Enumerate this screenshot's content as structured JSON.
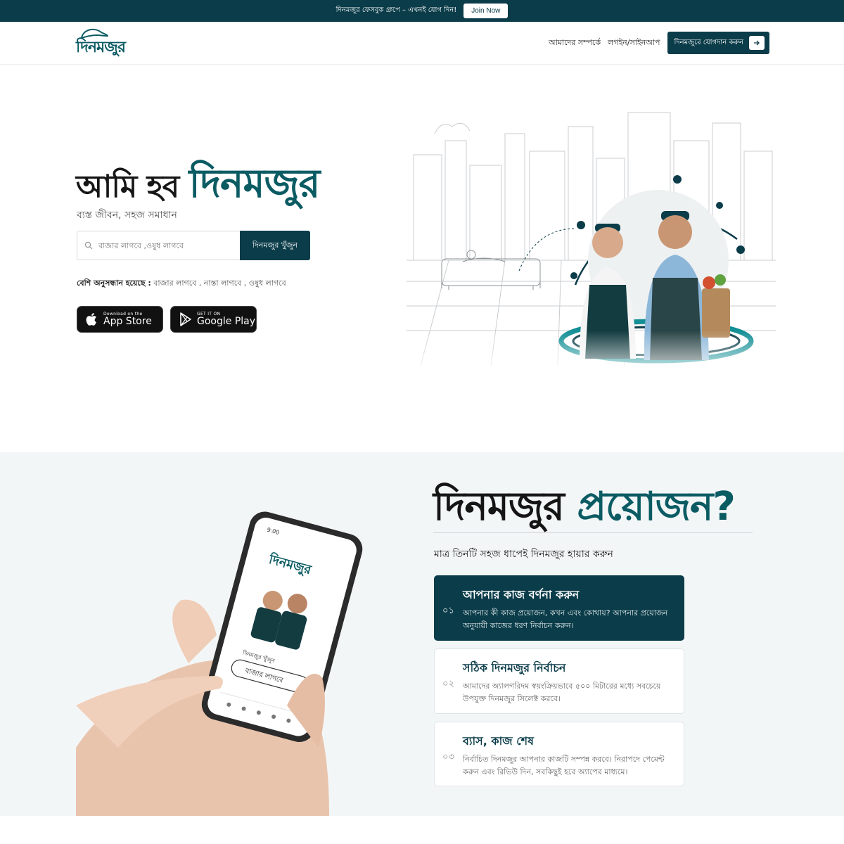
{
  "announcement": {
    "text": "দিনমজুর ফেসবুক গ্রুপে – এখনই যোগ দিন!",
    "button": "Join Now"
  },
  "header": {
    "logo_text": "দিনমজুর",
    "nav": [
      {
        "label": "আমাদের সম্পর্কে"
      },
      {
        "label": "লগইন/সাইনআপ"
      }
    ],
    "cta": "দিনমজুরে যোগদান করুন"
  },
  "hero": {
    "title_plain": "আমি হব",
    "title_accent": "দিনমজুর",
    "subtitle": "ব্যস্ত জীবন, সহজ সমাধান",
    "search_placeholder": "বাজার লাগবে ,ওষুধ লাগবে",
    "search_button": "দিনমজুর খুঁজুন",
    "popular_label": "বেশি অনুসন্ধান হয়েছে :",
    "popular_items": "বাজার লাগবে , নাস্তা লাগবে , ওষুধ লাগবে",
    "app_store": {
      "small": "Download on the",
      "big": "App Store"
    },
    "google_play": {
      "small": "GET IT ON",
      "big": "Google Play"
    }
  },
  "section2": {
    "title_plain": "দিনমজুর",
    "title_accent": "প্রয়োজন?",
    "subtitle": "মাত্র তিনটি সহজ ধাপেই দিনমজুর হায়ার করুন",
    "phone_texts": {
      "logo": "দিনমজুর",
      "search_label": "দিনমজুর খুঁজুন",
      "search_value": "বাজার লাগবে",
      "time": "9:00"
    },
    "steps": [
      {
        "num": "০১",
        "title": "আপনার কাজ বর্ণনা করুন",
        "desc": "আপনার কী কাজ প্রয়োজন, কখন এবং কোথায়? আপনার প্রয়োজন অনুযায়ী কাজের ধরণ নির্বাচন করুন।"
      },
      {
        "num": "০২",
        "title": "সঠিক দিনমজুর নির্বাচন",
        "desc": "আমাদের অ্যালগরিদম স্বয়ংক্রিয়ভাবে ৫০০ মিটারের মধ্যে সবচেয়ে উপযুক্ত দিনমজুর সিলেক্ট করবে।"
      },
      {
        "num": "০৩",
        "title": "ব্যাস, কাজ শেষ",
        "desc": "নির্বাচিত দিনমজুর আপনার কাজটি সম্পন্ন করবে। নিরাপদে পেমেন্ট করুন এবং রিভিউ দিন, সবকিছুই হবে অ্যাপের মাধ্যমে।"
      }
    ]
  },
  "colors": {
    "brand_dark": "#0b3c49",
    "brand_teal": "#0b5b63",
    "section_bg": "#f3f6f7"
  }
}
